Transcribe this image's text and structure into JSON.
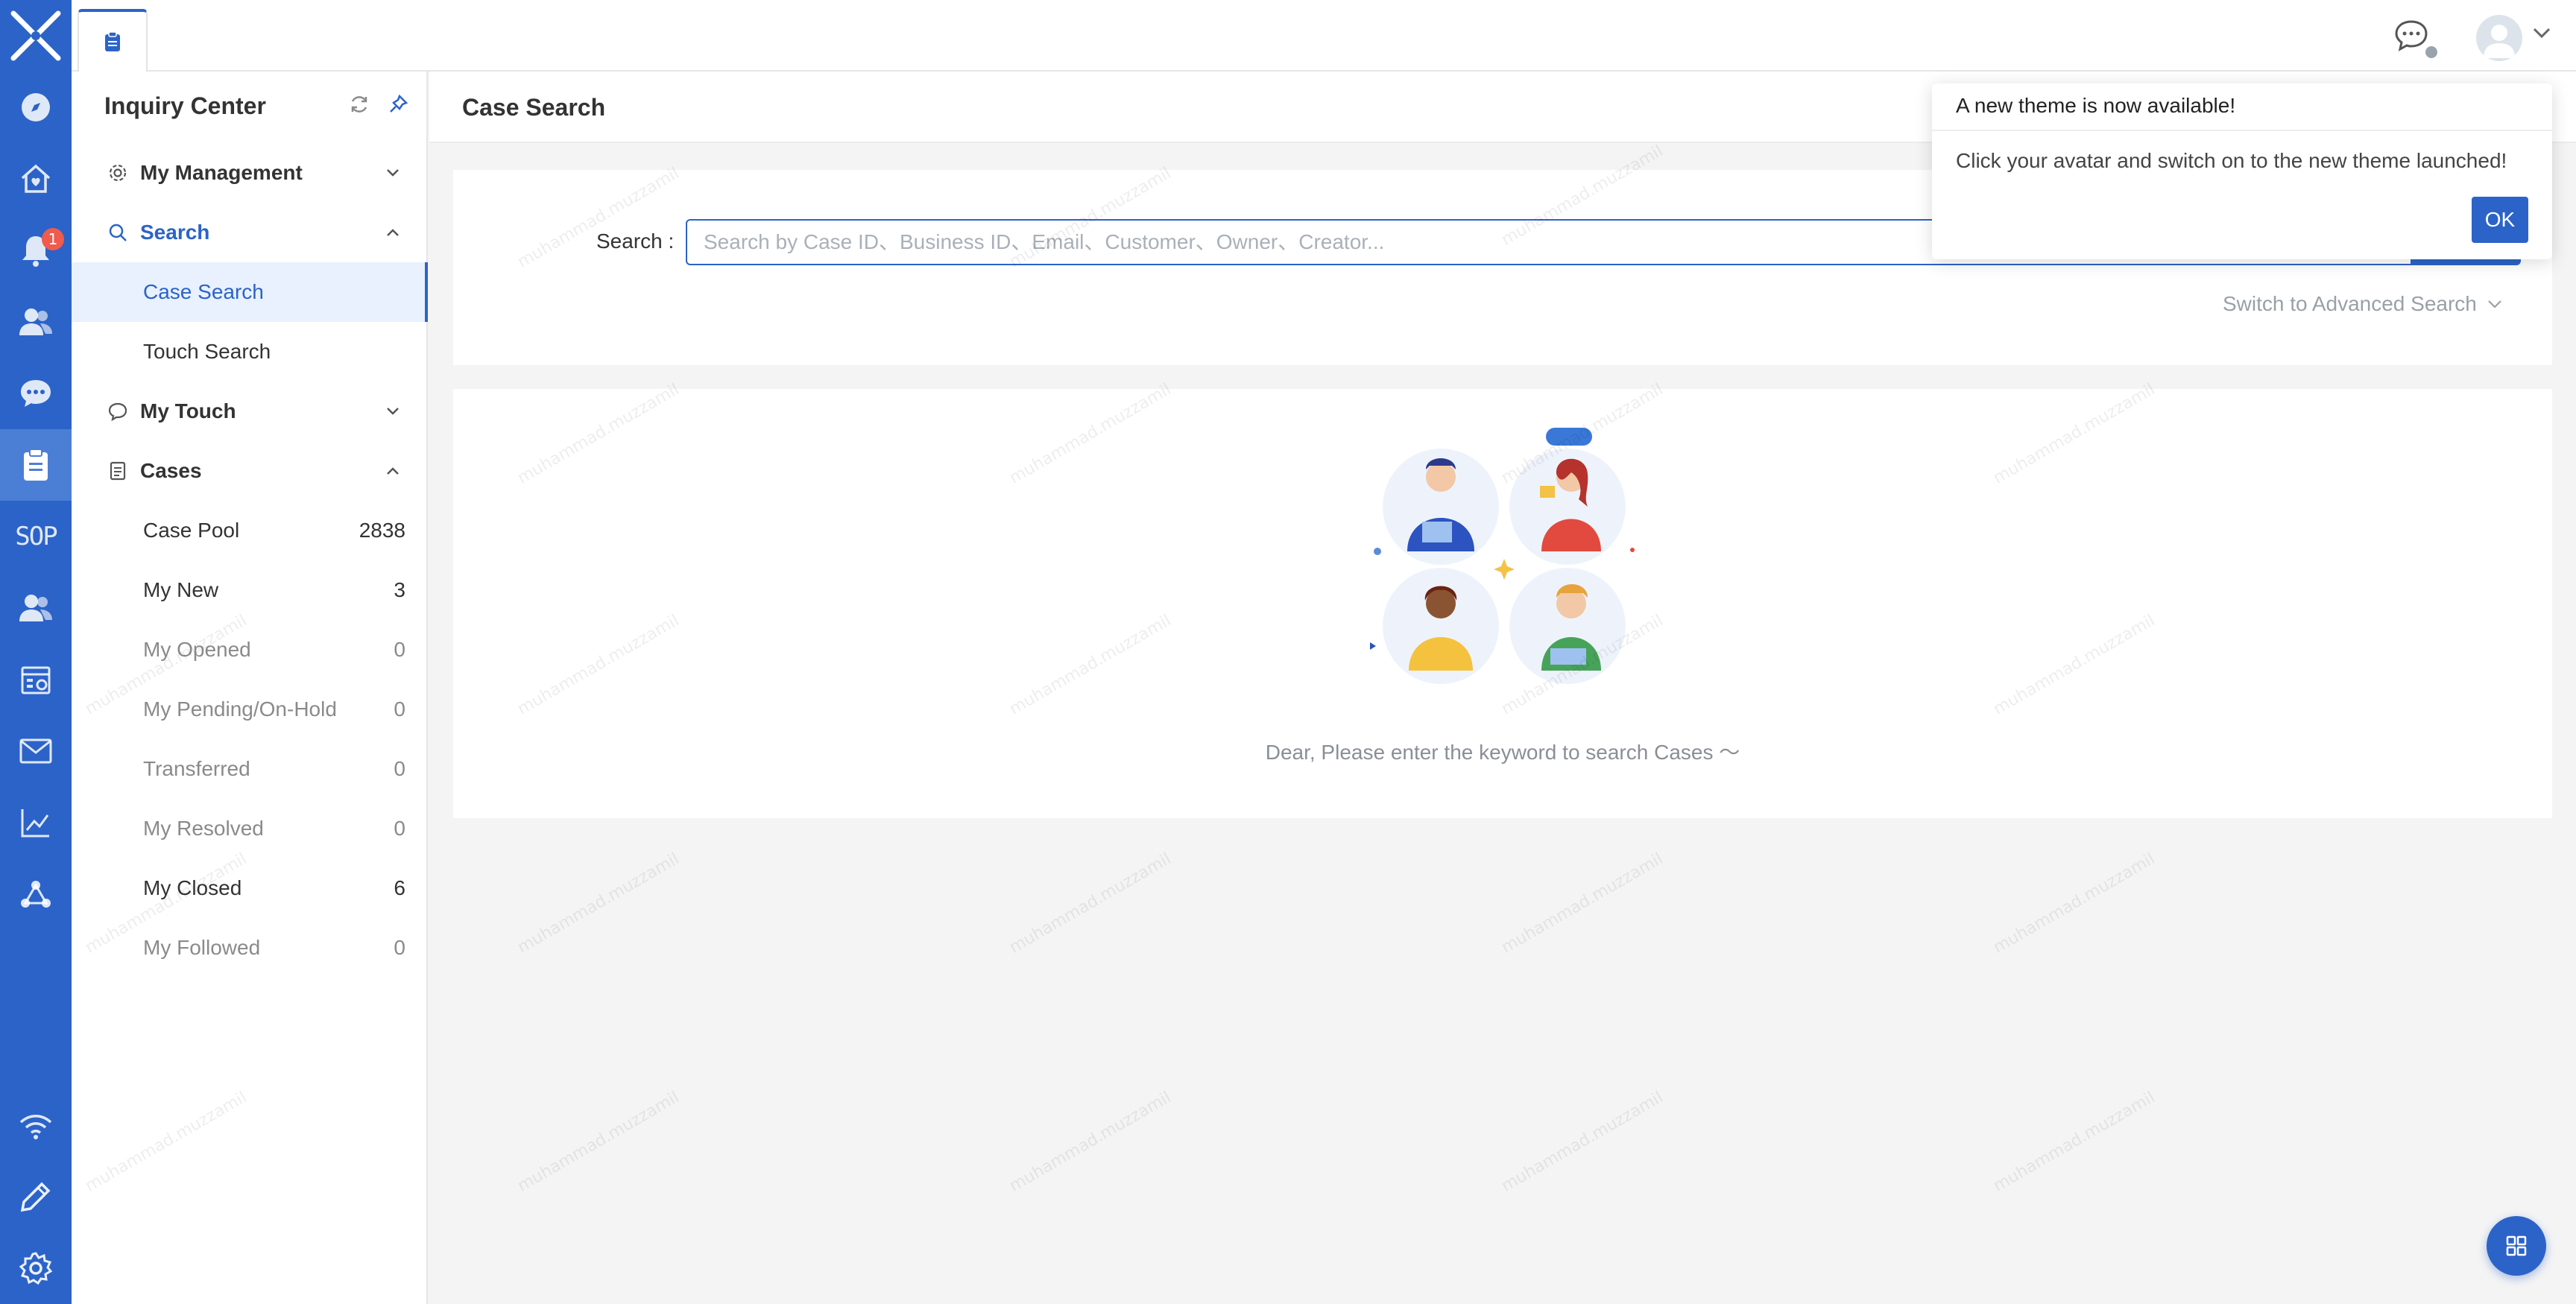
{
  "rail": {
    "notifications_badge": "1",
    "sop_label": "SOP"
  },
  "sidebar": {
    "title": "Inquiry Center",
    "groups": {
      "management": {
        "label": "My Management"
      },
      "search": {
        "label": "Search"
      },
      "touch": {
        "label": "My Touch"
      },
      "cases": {
        "label": "Cases"
      }
    },
    "search_items": [
      {
        "label": "Case Search"
      },
      {
        "label": "Touch Search"
      }
    ],
    "case_items": [
      {
        "label": "Case Pool",
        "count": "2838"
      },
      {
        "label": "My New",
        "count": "3"
      },
      {
        "label": "My Opened",
        "count": "0"
      },
      {
        "label": "My Pending/On-Hold",
        "count": "0"
      },
      {
        "label": "Transferred",
        "count": "0"
      },
      {
        "label": "My Resolved",
        "count": "0"
      },
      {
        "label": "My Closed",
        "count": "6"
      },
      {
        "label": "My Followed",
        "count": "0"
      }
    ]
  },
  "main": {
    "page_title": "Case Search",
    "search_label": "Search :",
    "search_placeholder": "Search by Case ID、Business ID、Email、Customer、Owner、Creator...",
    "search_value": "",
    "advanced_link": "Switch to Advanced Search",
    "empty_text": "Dear, Please enter the keyword to search Cases ～"
  },
  "popup": {
    "title": "A new theme is now available!",
    "body": "Click your avatar and switch on to the new theme launched!",
    "ok_label": "OK"
  },
  "watermark": "muhammad.muzzamil"
}
